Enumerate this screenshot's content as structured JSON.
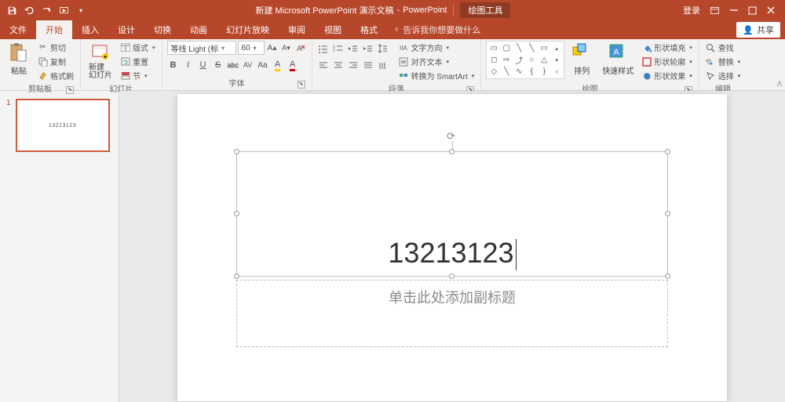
{
  "title": {
    "doc": "新建 Microsoft PowerPoint 演示文稿",
    "app": "PowerPoint",
    "context": "绘图工具",
    "login": "登录"
  },
  "tabs": {
    "file": "文件",
    "home": "开始",
    "insert": "插入",
    "design": "设计",
    "transition": "切换",
    "animation": "动画",
    "slideshow": "幻灯片放映",
    "review": "审阅",
    "view": "视图",
    "format": "格式"
  },
  "tellme": "告诉我你想要做什么",
  "share": "共享",
  "ribbon": {
    "clipboard": {
      "paste": "粘贴",
      "cut": "剪切",
      "copy": "复制",
      "painter": "格式刷",
      "label": "剪贴板"
    },
    "slides": {
      "new": "新建\n幻灯片",
      "layout": "版式",
      "reset": "重置",
      "section": "节",
      "label": "幻灯片"
    },
    "font": {
      "name": "等线 Light (标",
      "size": "60",
      "label": "字体"
    },
    "para": {
      "label": "段落",
      "textdir": "文字方向",
      "align": "对齐文本",
      "smartart": "转换为 SmartArt"
    },
    "draw": {
      "arrange": "排列",
      "quick": "快速样式",
      "fill": "形状填充",
      "outline": "形状轮廓",
      "effects": "形状效果",
      "label": "绘图"
    },
    "edit": {
      "find": "查找",
      "replace": "替换",
      "select": "选择",
      "label": "编辑"
    }
  },
  "thumb": {
    "num": "1",
    "text": "13213123"
  },
  "slide": {
    "title": "13213123",
    "subtitle": "单击此处添加副标题"
  }
}
